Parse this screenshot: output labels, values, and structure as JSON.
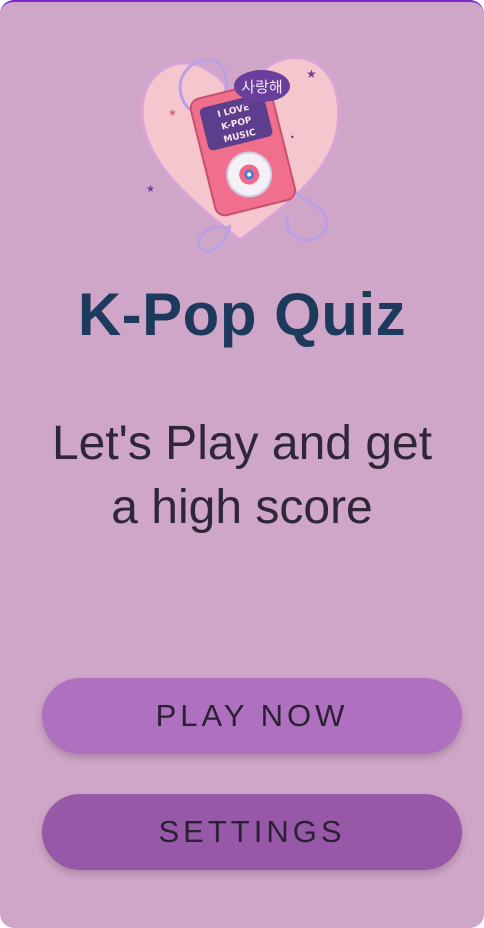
{
  "hero": {
    "speech_bubble": "사랑해",
    "player_screen_text": [
      "I LOVE",
      "K-POP",
      "MUSIC"
    ]
  },
  "title": "K-Pop Quiz",
  "subtitle": "Let's Play and get a high score",
  "buttons": {
    "play_label": "PLAY NOW",
    "settings_label": "SETTINGS"
  },
  "colors": {
    "background": "#cfa6c8",
    "title": "#1d3a5d",
    "play_button": "#b070c0",
    "settings_button": "#9858a8"
  }
}
